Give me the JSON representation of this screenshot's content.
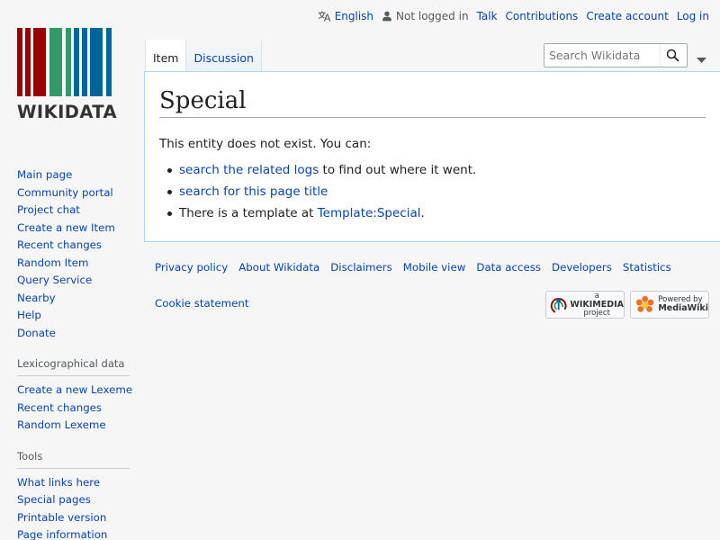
{
  "personal": {
    "language": "English",
    "not_logged_in": "Not logged in",
    "talk": "Talk",
    "contributions": "Contributions",
    "create_account": "Create account",
    "log_in": "Log in"
  },
  "logo": {
    "wordmark": "WIKIDATA",
    "colors": [
      "#990000",
      "#339966",
      "#006699"
    ]
  },
  "tabs": {
    "item": "Item",
    "discussion": "Discussion"
  },
  "search": {
    "placeholder": "Search Wikidata"
  },
  "page": {
    "title": "Special",
    "intro": "This entity does not exist. You can:",
    "items": [
      {
        "link": "search the related logs",
        "after": " to find out where it went."
      },
      {
        "link": "search for this page title",
        "after": ""
      },
      {
        "before": "There is a template at ",
        "link": "Template:Special",
        "after": "."
      }
    ]
  },
  "sidebar": {
    "navigation": [
      "Main page",
      "Community portal",
      "Project chat",
      "Create a new Item",
      "Recent changes",
      "Random Item",
      "Query Service",
      "Nearby",
      "Help",
      "Donate"
    ],
    "lexicographical": {
      "heading": "Lexicographical data",
      "items": [
        "Create a new Lexeme",
        "Recent changes",
        "Random Lexeme"
      ]
    },
    "tools": {
      "heading": "Tools",
      "items": [
        "What links here",
        "Special pages",
        "Printable version",
        "Page information"
      ]
    }
  },
  "footer": {
    "links": [
      "Privacy policy",
      "About Wikidata",
      "Disclaimers",
      "Mobile view",
      "Data access",
      "Developers",
      "Statistics"
    ],
    "cookie": "Cookie statement",
    "wikimedia_badge": {
      "line1": "a",
      "line2": "WIKIMEDIA",
      "line3": "project"
    },
    "mediawiki_badge": {
      "line1": "Powered by",
      "line2": "MediaWiki"
    }
  }
}
